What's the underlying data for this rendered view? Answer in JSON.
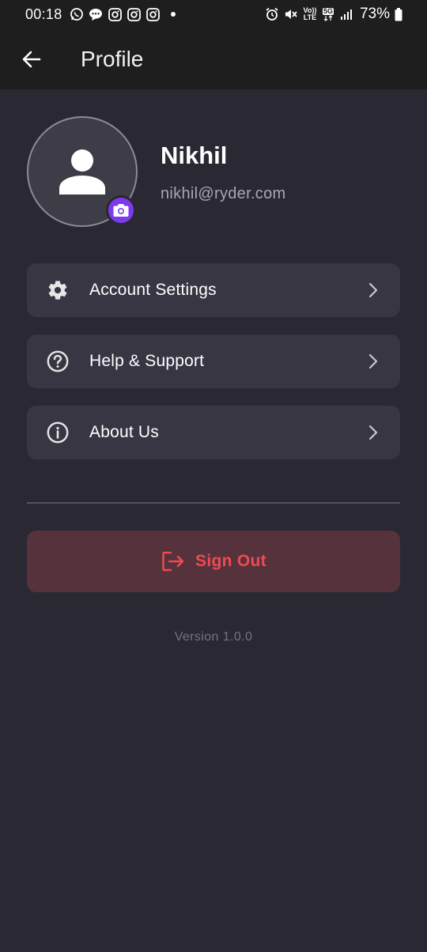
{
  "status_bar": {
    "time": "00:18",
    "battery": "73%",
    "network_badge": "5G",
    "volte_top": "Vo))",
    "volte_bottom": "LTE",
    "left_icons": [
      "whatsapp-icon",
      "message-icon",
      "instagram-icon",
      "instagram-icon",
      "instagram-icon",
      "notification-dot-icon"
    ],
    "right_icons": [
      "alarm-icon",
      "mute-icon",
      "volte-icon",
      "5g-icon",
      "signal-icon",
      "battery-icon"
    ]
  },
  "app_bar": {
    "title": "Profile",
    "back_icon": "arrow-left-icon"
  },
  "profile": {
    "name": "Nikhil",
    "email": "nikhil@ryder.com",
    "avatar_icon": "person-icon",
    "camera_icon": "camera-icon",
    "accent_color": "#7c3aed"
  },
  "menu": {
    "items": [
      {
        "label": "Account Settings",
        "icon": "gear-icon"
      },
      {
        "label": "Help & Support",
        "icon": "help-circle-icon"
      },
      {
        "label": "About Us",
        "icon": "info-circle-icon"
      }
    ]
  },
  "sign_out": {
    "label": "Sign Out",
    "icon": "logout-icon",
    "color": "#ef4a52"
  },
  "footer": {
    "version": "Version 1.0.0"
  }
}
